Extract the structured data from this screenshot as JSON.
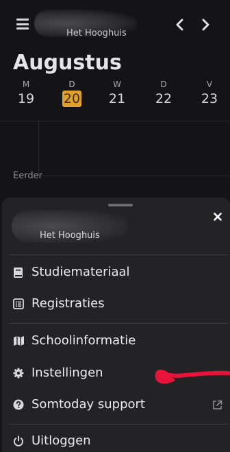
{
  "header": {
    "school_name": "Het Hooghuis",
    "month": "Augustus",
    "menu_icon": "hamburger-icon",
    "prev_icon": "chevron-left-icon",
    "next_icon": "chevron-right-icon"
  },
  "week": [
    {
      "letter": "M",
      "number": "19",
      "today": false
    },
    {
      "letter": "D",
      "number": "20",
      "today": true
    },
    {
      "letter": "W",
      "number": "21",
      "today": false
    },
    {
      "letter": "D",
      "number": "22",
      "today": false
    },
    {
      "letter": "V",
      "number": "23",
      "today": false
    }
  ],
  "colors": {
    "today_highlight": "#e1a22b",
    "background": "#141416",
    "sheet": "#232326",
    "annotation": "#e8133a"
  },
  "agenda": {
    "earlier_label": "Eerder"
  },
  "sheet": {
    "school_name": "Het Hooghuis",
    "close_icon": "close-icon",
    "menu": [
      {
        "label": "Studiemateriaal",
        "icon": "book-icon"
      },
      {
        "label": "Registraties",
        "icon": "list-icon"
      },
      {
        "label": "Schoolinformatie",
        "icon": "map-icon"
      },
      {
        "label": "Instellingen",
        "icon": "gear-icon"
      },
      {
        "label": "Somtoday support",
        "icon": "question-circle-icon",
        "external_icon": "external-link-icon"
      },
      {
        "label": "Uitloggen",
        "icon": "power-icon"
      }
    ]
  }
}
